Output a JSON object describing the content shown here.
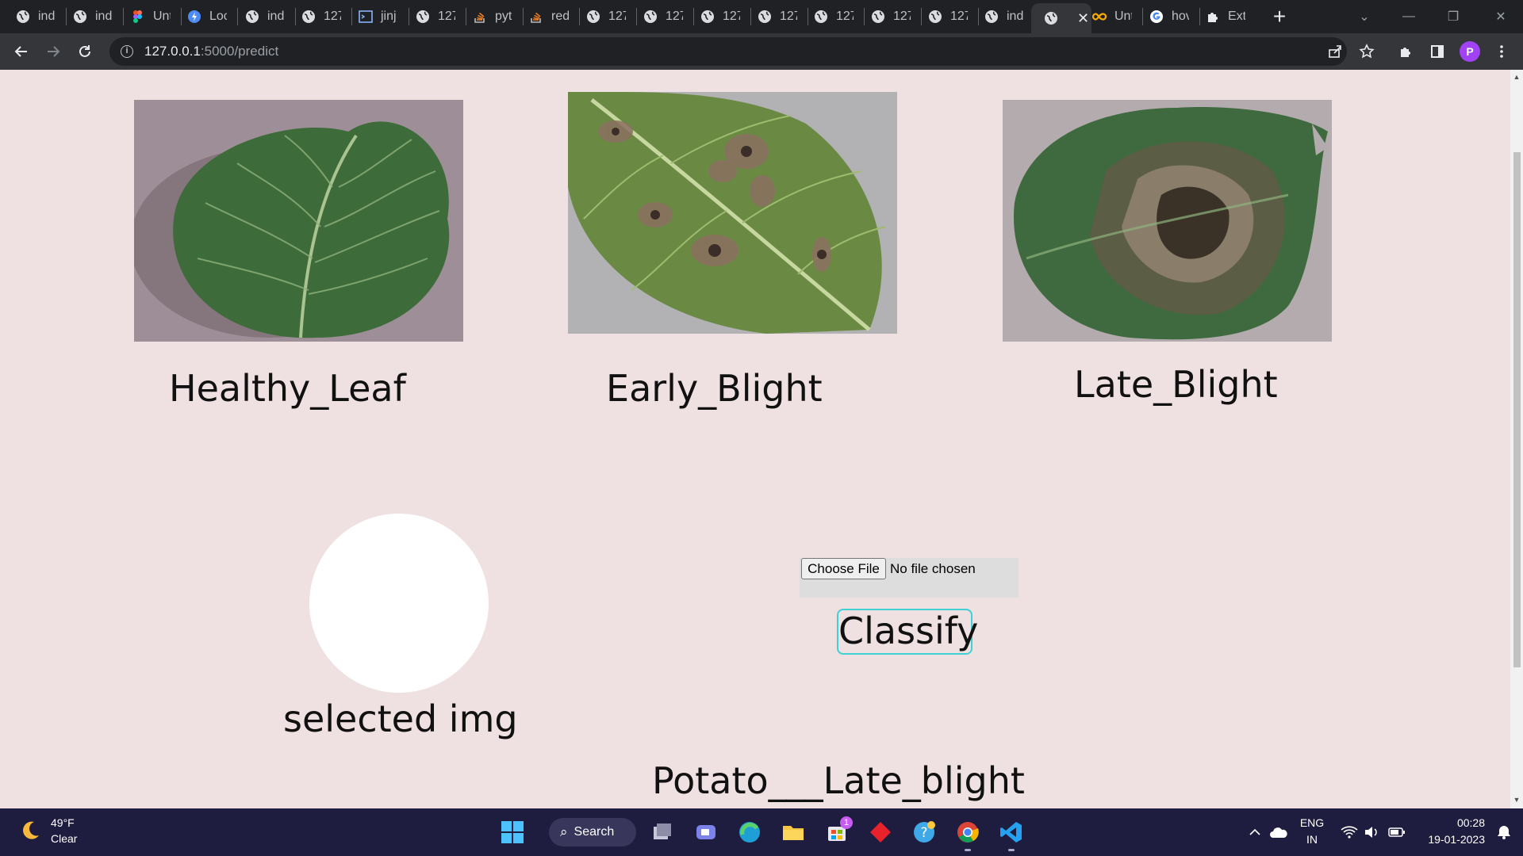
{
  "browser": {
    "tabs": [
      {
        "label": "ind",
        "icon": "globe-icon"
      },
      {
        "label": "ind",
        "icon": "globe-icon"
      },
      {
        "label": "Unt",
        "icon": "figma-icon"
      },
      {
        "label": "Loc",
        "icon": "bolt-icon"
      },
      {
        "label": "ind",
        "icon": "globe-icon"
      },
      {
        "label": "127",
        "icon": "globe-icon"
      },
      {
        "label": "jinj",
        "icon": "terminal-icon"
      },
      {
        "label": "127",
        "icon": "globe-icon"
      },
      {
        "label": "pyt",
        "icon": "stackoverflow-icon"
      },
      {
        "label": "red",
        "icon": "stackoverflow-icon"
      },
      {
        "label": "127",
        "icon": "globe-icon"
      },
      {
        "label": "127",
        "icon": "globe-icon"
      },
      {
        "label": "127",
        "icon": "globe-icon"
      },
      {
        "label": "127",
        "icon": "globe-icon"
      },
      {
        "label": "127",
        "icon": "globe-icon"
      },
      {
        "label": "127",
        "icon": "globe-icon"
      },
      {
        "label": "127",
        "icon": "globe-icon"
      },
      {
        "label": "ind",
        "icon": "globe-icon"
      },
      {
        "label": "",
        "icon": "globe-icon",
        "active": true
      },
      {
        "label": "Unt",
        "icon": "infinity-icon"
      },
      {
        "label": "hov",
        "icon": "google-icon"
      },
      {
        "label": "Ext",
        "icon": "puzzle-icon"
      }
    ],
    "url_host": "127.0.0.1",
    "url_path": ":5000/predict",
    "profile_initial": "P"
  },
  "page": {
    "examples": [
      {
        "label": "Healthy_Leaf"
      },
      {
        "label": "Early_Blight"
      },
      {
        "label": "Late_Blight"
      }
    ],
    "selected_label": "selected img",
    "file_button": "Choose File",
    "file_status": "No file chosen",
    "classify_label": "Classify",
    "result": "Potato___Late_blight"
  },
  "taskbar": {
    "weather_temp": "49°F",
    "weather_desc": "Clear",
    "search_label": "Search",
    "store_badge": "1",
    "lang_top": "ENG",
    "lang_bottom": "IN",
    "time": "00:28",
    "date": "19-01-2023"
  },
  "colors": {
    "page_bg": "#efe0e1",
    "accent_border": "#3ed1d6",
    "taskbar_bg": "#1f1d3f"
  }
}
